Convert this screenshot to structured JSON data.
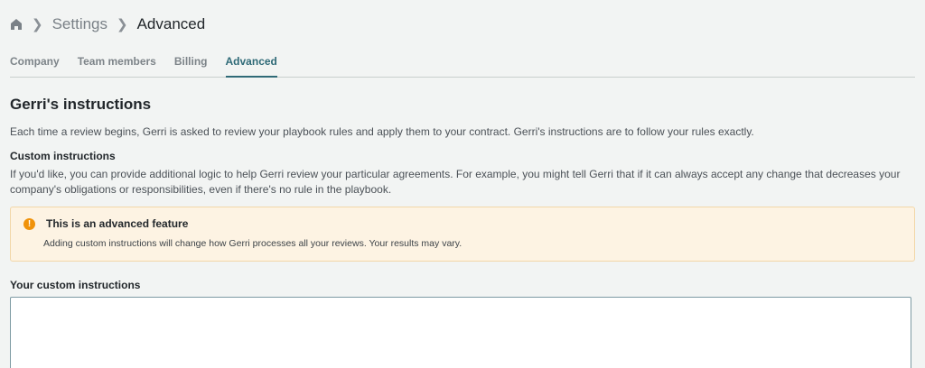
{
  "breadcrumb": {
    "home_icon": "home-icon",
    "items": [
      {
        "label": "Settings"
      },
      {
        "label": "Advanced"
      }
    ]
  },
  "tabs": [
    {
      "label": "Company"
    },
    {
      "label": "Team members"
    },
    {
      "label": "Billing"
    },
    {
      "label": "Advanced",
      "active": true
    }
  ],
  "section": {
    "title": "Gerri's instructions",
    "description": "Each time a review begins, Gerri is asked to review your playbook rules and apply them to your contract. Gerri's instructions are to follow your rules exactly.",
    "custom_heading": "Custom instructions",
    "custom_description": "If you'd like, you can provide additional logic to help Gerri review your particular agreements. For example, you might tell Gerri that if it can always accept any change that decreases your company's obligations or responsibilities, even if there's no rule in the playbook."
  },
  "alert": {
    "icon": "warning-icon",
    "icon_glyph": "!",
    "title": "This is an advanced feature",
    "body": "Adding custom instructions will change how Gerri processes all your reviews. Your results may vary.",
    "color": "#f0920a"
  },
  "custom_instructions": {
    "label": "Your custom instructions",
    "value": "",
    "placeholder": ""
  },
  "colors": {
    "accent": "#2f6a77",
    "background": "#f2f4f3",
    "alert_bg": "#fdf3e3"
  }
}
